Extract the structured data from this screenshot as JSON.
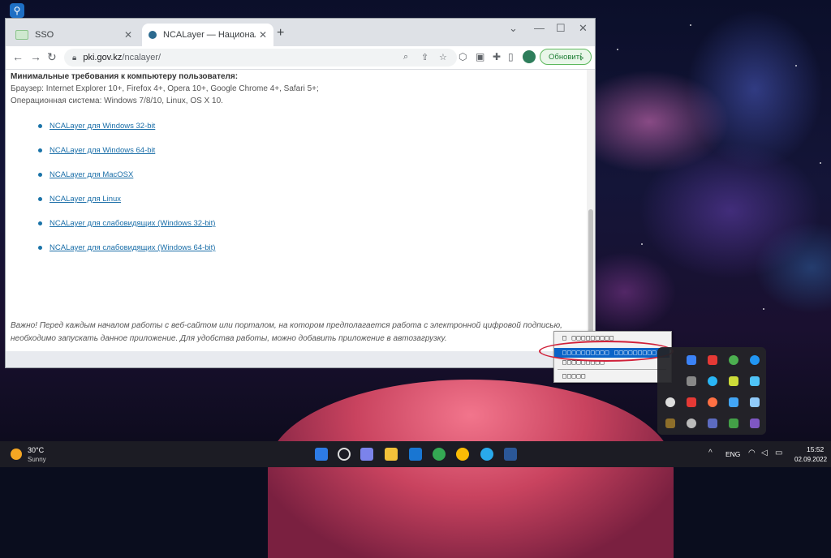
{
  "browser": {
    "tabs": [
      {
        "title": "SSO",
        "active": false
      },
      {
        "title": "NCALayer — Национальный уд",
        "active": true
      }
    ],
    "new_tab": "+",
    "window_controls": {
      "minimize": "—",
      "maximize": "☐",
      "close": "✕"
    },
    "url_domain": "pki.gov.kz",
    "url_path": "/ncalayer/",
    "update_label": "Обновить"
  },
  "page": {
    "requirements_heading": "Минимальные требования к компьютеру пользователя:",
    "browser_req": "Браузер: Internet Explorer 10+, Firefox 4+, Opera 10+, Google Chrome 4+, Safari 5+;",
    "os_req": "Операционная система: Windows 7/8/10, Linux, OS X 10.",
    "downloads": [
      "NCALayer для Windows 32-bit",
      "NCALayer для Windows 64-bit",
      "NCALayer для MacOSX",
      "NCALayer для Linux",
      "NCALayer для слабовидящих (Windows 32-bit)",
      "NCALayer для слабовидящих (Windows 64-bit)"
    ],
    "note": "Важно! Перед каждым началом работы с веб-сайтом или порталом, на котором предполагается работа с электронной цифровой подписью, необходимо запускать данное приложение. Для удобства работы, можно добавить приложение в автозагрузку."
  },
  "context_menu": {
    "items": [
      "□ □□□□□□□□□",
      "□□□□□□□□□□ □□□□□□□□□",
      "□□□□□□□□□",
      "□□□□□"
    ],
    "highlighted_index": 1
  },
  "taskbar": {
    "temperature": "30°C",
    "condition": "Sunny",
    "language": "ENG",
    "time": "15:52",
    "date": "02.09.2022"
  },
  "colors": {
    "accent": "#0a64c8",
    "link": "#1a6ea8",
    "highlight_oval": "#d0213a",
    "update_green": "#5cb85c"
  }
}
